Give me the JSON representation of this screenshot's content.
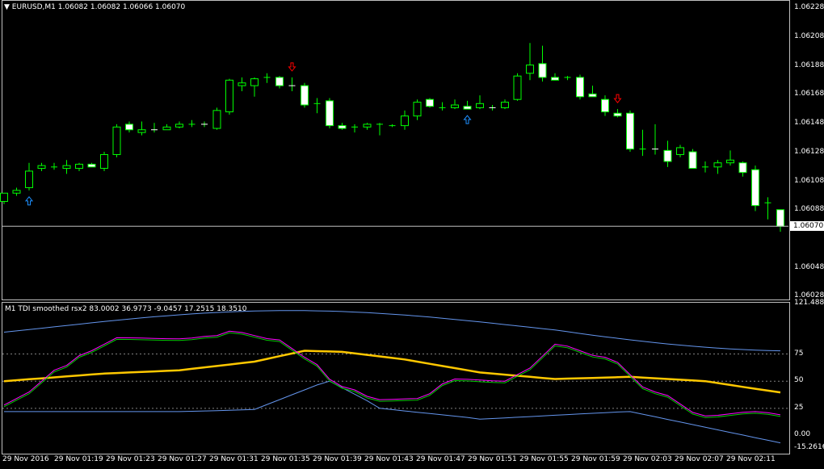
{
  "chart_header": {
    "symbol_text": "EURUSD,M1",
    "ohlc_text": "1.06082 1.06082 1.06066 1.06070"
  },
  "indicator_header": {
    "text": "M1 TDI smoothed rsx2 83.0002 36.9773 -9.0457 17.2515 18.3510"
  },
  "price_axis": [
    "1.06228",
    "1.06208",
    "1.06188",
    "1.06168",
    "1.06148",
    "1.06128",
    "1.06108",
    "1.06088",
    "1.06048",
    "1.06028"
  ],
  "current_price": "1.06070",
  "indicator_axis": [
    "121.4887",
    "75",
    "50",
    "25",
    "0.00",
    "-15.2616"
  ],
  "time_axis": [
    "29 Nov 2016",
    "29 Nov 01:19",
    "29 Nov 01:23",
    "29 Nov 01:27",
    "29 Nov 01:31",
    "29 Nov 01:35",
    "29 Nov 01:39",
    "29 Nov 01:43",
    "29 Nov 01:47",
    "29 Nov 01:51",
    "29 Nov 01:55",
    "29 Nov 01:59",
    "29 Nov 02:03",
    "29 Nov 02:07",
    "29 Nov 02:11"
  ],
  "colors": {
    "bull": "#00ff00",
    "bear_body": "#ffffff",
    "buy_arrow": "#1e90ff",
    "sell_arrow": "#ff0000",
    "tdi_green": "#00c800",
    "tdi_magenta": "#ff00ff",
    "tdi_yellow": "#ffc800",
    "tdi_blue": "#6495ed"
  },
  "chart_data": {
    "type": "candlestick",
    "ylim": [
      1.06018,
      1.06233
    ],
    "levels_indicator": [
      75,
      50,
      25
    ],
    "indicator_ylim": [
      -15.2616,
      121.4887
    ],
    "candles": [
      {
        "o": 1.06088,
        "h": 1.06094,
        "l": 1.06086,
        "c": 1.06094
      },
      {
        "o": 1.06094,
        "h": 1.06098,
        "l": 1.06092,
        "c": 1.06096
      },
      {
        "o": 1.06098,
        "h": 1.06116,
        "l": 1.06096,
        "c": 1.0611
      },
      {
        "o": 1.06112,
        "h": 1.06116,
        "l": 1.0611,
        "c": 1.06114
      },
      {
        "o": 1.06112,
        "h": 1.06116,
        "l": 1.06111,
        "c": 1.06113
      },
      {
        "o": 1.06112,
        "h": 1.06118,
        "l": 1.06108,
        "c": 1.06114
      },
      {
        "o": 1.06112,
        "h": 1.06116,
        "l": 1.0611,
        "c": 1.06115
      },
      {
        "o": 1.06115,
        "h": 1.06116,
        "l": 1.06113,
        "c": 1.06113
      },
      {
        "o": 1.06112,
        "h": 1.06124,
        "l": 1.0611,
        "c": 1.06122
      },
      {
        "o": 1.06122,
        "h": 1.06144,
        "l": 1.0612,
        "c": 1.06142
      },
      {
        "o": 1.06144,
        "h": 1.06146,
        "l": 1.06138,
        "c": 1.0614
      },
      {
        "o": 1.06138,
        "h": 1.06146,
        "l": 1.06136,
        "c": 1.0614
      },
      {
        "o": 1.0614,
        "h": 1.06145,
        "l": 1.06138,
        "c": 1.06139
      },
      {
        "o": 1.0614,
        "h": 1.06144,
        "l": 1.0614,
        "c": 1.06142
      },
      {
        "o": 1.06142,
        "h": 1.06146,
        "l": 1.06141,
        "c": 1.06144
      },
      {
        "o": 1.06143,
        "h": 1.06147,
        "l": 1.06142,
        "c": 1.06144
      },
      {
        "o": 1.06144,
        "h": 1.06146,
        "l": 1.06142,
        "c": 1.06143
      },
      {
        "o": 1.06141,
        "h": 1.06156,
        "l": 1.0614,
        "c": 1.06154
      },
      {
        "o": 1.06153,
        "h": 1.06177,
        "l": 1.06151,
        "c": 1.06176
      },
      {
        "o": 1.06172,
        "h": 1.06178,
        "l": 1.06168,
        "c": 1.06174
      },
      {
        "o": 1.06172,
        "h": 1.06178,
        "l": 1.06164,
        "c": 1.06177
      },
      {
        "o": 1.06177,
        "h": 1.06181,
        "l": 1.06174,
        "c": 1.06178
      },
      {
        "o": 1.06178,
        "h": 1.06179,
        "l": 1.0617,
        "c": 1.06172
      },
      {
        "o": 1.06172,
        "h": 1.06178,
        "l": 1.06168,
        "c": 1.06171
      },
      {
        "o": 1.06172,
        "h": 1.06174,
        "l": 1.06156,
        "c": 1.06158
      },
      {
        "o": 1.06158,
        "h": 1.06163,
        "l": 1.06152,
        "c": 1.06159
      },
      {
        "o": 1.06161,
        "h": 1.06163,
        "l": 1.06141,
        "c": 1.06143
      },
      {
        "o": 1.06143,
        "h": 1.06145,
        "l": 1.0614,
        "c": 1.06141
      },
      {
        "o": 1.06141,
        "h": 1.06144,
        "l": 1.06138,
        "c": 1.06142
      },
      {
        "o": 1.06142,
        "h": 1.06145,
        "l": 1.0614,
        "c": 1.06144
      },
      {
        "o": 1.06143,
        "h": 1.06145,
        "l": 1.06136,
        "c": 1.06144
      },
      {
        "o": 1.06143,
        "h": 1.06144,
        "l": 1.06142,
        "c": 1.06143
      },
      {
        "o": 1.06143,
        "h": 1.06154,
        "l": 1.0614,
        "c": 1.0615
      },
      {
        "o": 1.0615,
        "h": 1.06162,
        "l": 1.06147,
        "c": 1.0616
      },
      {
        "o": 1.06162,
        "h": 1.06163,
        "l": 1.06156,
        "c": 1.06157
      },
      {
        "o": 1.06156,
        "h": 1.0616,
        "l": 1.06154,
        "c": 1.06156
      },
      {
        "o": 1.06156,
        "h": 1.06162,
        "l": 1.06155,
        "c": 1.06158
      },
      {
        "o": 1.06157,
        "h": 1.06161,
        "l": 1.06155,
        "c": 1.06155
      },
      {
        "o": 1.06156,
        "h": 1.06165,
        "l": 1.06155,
        "c": 1.06159
      },
      {
        "o": 1.06156,
        "h": 1.06158,
        "l": 1.06154,
        "c": 1.06155
      },
      {
        "o": 1.06156,
        "h": 1.06162,
        "l": 1.06155,
        "c": 1.0616
      },
      {
        "o": 1.06162,
        "h": 1.06181,
        "l": 1.06161,
        "c": 1.06179
      },
      {
        "o": 1.06181,
        "h": 1.06203,
        "l": 1.06176,
        "c": 1.06187
      },
      {
        "o": 1.06188,
        "h": 1.06201,
        "l": 1.06175,
        "c": 1.06178
      },
      {
        "o": 1.06178,
        "h": 1.06181,
        "l": 1.06176,
        "c": 1.06176
      },
      {
        "o": 1.06177,
        "h": 1.06179,
        "l": 1.06176,
        "c": 1.06178
      },
      {
        "o": 1.06178,
        "h": 1.0618,
        "l": 1.06162,
        "c": 1.06164
      },
      {
        "o": 1.06166,
        "h": 1.06172,
        "l": 1.06164,
        "c": 1.06164
      },
      {
        "o": 1.06162,
        "h": 1.06165,
        "l": 1.0615,
        "c": 1.06153
      },
      {
        "o": 1.06152,
        "h": 1.06155,
        "l": 1.06149,
        "c": 1.0615
      },
      {
        "o": 1.06152,
        "h": 1.06154,
        "l": 1.06124,
        "c": 1.06126
      },
      {
        "o": 1.06125,
        "h": 1.0614,
        "l": 1.06121,
        "c": 1.06126
      },
      {
        "o": 1.06126,
        "h": 1.06144,
        "l": 1.06122,
        "c": 1.06125
      },
      {
        "o": 1.06125,
        "h": 1.06132,
        "l": 1.06113,
        "c": 1.06117
      },
      {
        "o": 1.06122,
        "h": 1.06129,
        "l": 1.0612,
        "c": 1.06127
      },
      {
        "o": 1.06124,
        "h": 1.06126,
        "l": 1.06113,
        "c": 1.06112
      },
      {
        "o": 1.06112,
        "h": 1.06117,
        "l": 1.06109,
        "c": 1.06113
      },
      {
        "o": 1.06113,
        "h": 1.06118,
        "l": 1.06108,
        "c": 1.06116
      },
      {
        "o": 1.06116,
        "h": 1.06125,
        "l": 1.06114,
        "c": 1.06118
      },
      {
        "o": 1.06116,
        "h": 1.06117,
        "l": 1.06106,
        "c": 1.06109
      },
      {
        "o": 1.06111,
        "h": 1.06114,
        "l": 1.06081,
        "c": 1.06085
      },
      {
        "o": 1.06087,
        "h": 1.06091,
        "l": 1.06075,
        "c": 1.06087
      },
      {
        "o": 1.06082,
        "h": 1.06082,
        "l": 1.06066,
        "c": 1.0607
      }
    ],
    "buy_arrows_at": [
      2,
      37
    ],
    "sell_arrows_at": [
      23,
      49
    ]
  }
}
